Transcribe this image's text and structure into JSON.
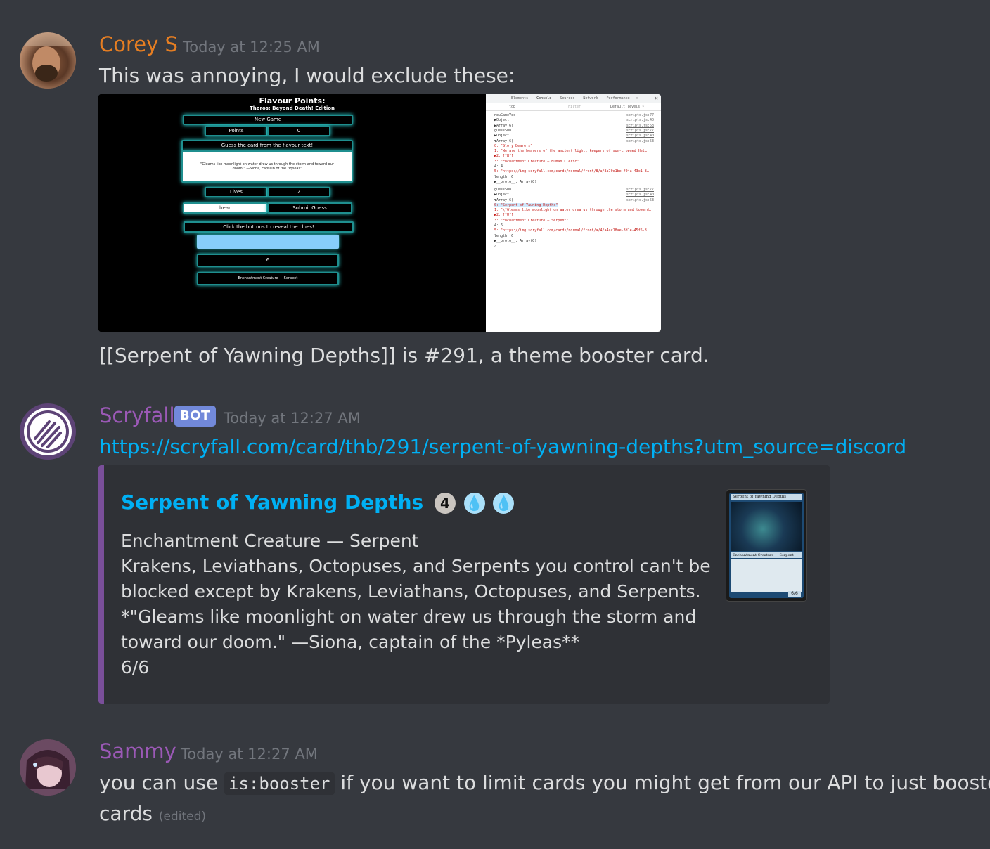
{
  "messages": [
    {
      "author": "Corey S",
      "author_color": "#e67e22",
      "timestamp": "Today at 12:25 AM",
      "text_before": "This was annoying, I would exclude these:",
      "text_after": "[[Serpent of Yawning Depths]] is #291, a theme booster card."
    },
    {
      "author": "Scryfall",
      "author_color": "#9b59b6",
      "badge": "BOT",
      "timestamp": "Today at 12:27 AM",
      "link": "https://scryfall.com/card/thb/291/serpent-of-yawning-depths?utm_source=discord",
      "embed": {
        "accent_color": "#7a4f9a",
        "title": "Serpent of Yawning Depths",
        "mana_cost": [
          "4",
          "U",
          "U"
        ],
        "desc_lines": [
          "Enchantment Creature — Serpent",
          "Krakens, Leviathans, Octopuses, and Serpents you control can't be",
          "blocked except by Krakens, Leviathans, Octopuses, and Serpents.",
          "*\"Gleams like moonlight on water drew us through the storm and",
          "toward our doom.\" —Siona, captain of the *Pyleas**",
          "6/6"
        ]
      }
    },
    {
      "author": "Sammy",
      "author_color": "#9b59b6",
      "timestamp": "Today at 12:27 AM",
      "text_part1": "you can use ",
      "code": "is:booster",
      "text_part2": " if you want to limit cards you might get from our API to just booster",
      "text_line2": "cards",
      "edited": "(edited)"
    }
  ],
  "screenshot": {
    "title": "Flavour Points:",
    "subtitle": "Theros: Beyond Death! Edition",
    "new_game": "New Game",
    "points_label": "Points",
    "points_value": "0",
    "guess_header": "Guess the card from the flavour text!",
    "flavour_text_1": "\"Gleams like moonlight on water drew us through the storm and toward our",
    "flavour_text_2": "doom.\" —Siona, captain of the \"Pyleas\"",
    "lives_label": "Lives",
    "lives_value": "2",
    "guess_input": "bear",
    "submit": "Submit Guess",
    "clue_header": "Click the buttons to reveal the clues!",
    "clue_2": "6",
    "clue_3": "Enchantment Creature — Serpent",
    "devtools_tabs": [
      "Elements",
      "Console",
      "Sources",
      "Network",
      "Performance",
      "»"
    ],
    "devtools_context": "top",
    "devtools_filter": "Filter",
    "devtools_levels": "Default levels ▾",
    "console_lines": [
      "newGameYes",
      "▶Object",
      "▶Array(6)",
      "guessSub",
      "▶Object",
      "▼Array(6)",
      "  0: \"Glory Bearers\"",
      "  1: \"We are the bearers of the ancient light, keepers of sun-crowned Hel…",
      "▶2: [\"W\"]",
      "  3: \"Enchantment Creature — Human Cleric\"",
      "  4: 4",
      "  5: \"https://img.scryfall.com/cards/normal/front/8/a/8a70e1be-f04a-43c1-8…",
      "  length: 6",
      "▶__proto__: Array(0)",
      "guessSub",
      "▶Object",
      "▼Array(6)",
      "  0: \"Serpent of Yawning Depths\"",
      "  1: \"\\\"Gleams like moonlight on water drew us through the storm and toward…",
      "▶2: [\"U\"]",
      "  3: \"Enchantment Creature — Serpent\"",
      "  4: 6",
      "  5: \"https://img.scryfall.com/cards/normal/front/a/4/a4ac18ae-8d1e-45f5-8…",
      "  length: 6",
      "▶__proto__: Array(0)",
      ">"
    ],
    "console_sources": [
      "scripts.js:77",
      "scripts.js:40",
      "scripts.js:53",
      "scripts.js:77",
      "scripts.js:40",
      "scripts.js:53",
      "scripts.js:77",
      "scripts.js:40",
      "scripts.js:53"
    ]
  },
  "card_thumb": {
    "name": "Serpent of Yawning Depths",
    "type": "Enchantment Creature — Serpent",
    "pt": "6/6"
  }
}
